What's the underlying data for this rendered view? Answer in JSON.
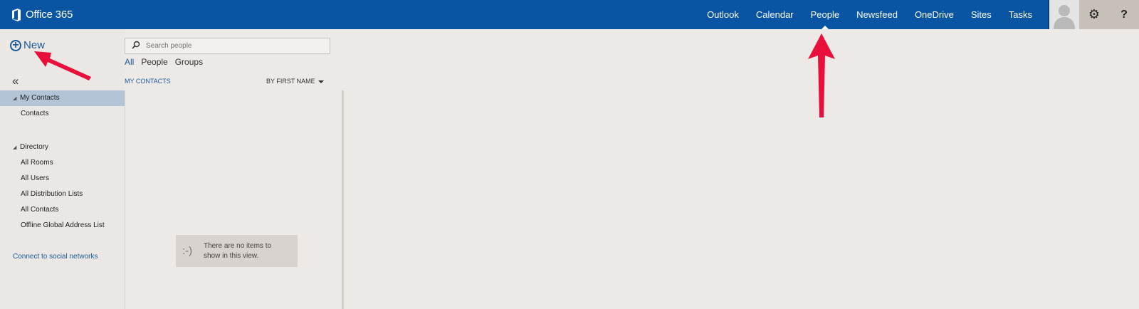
{
  "brand": {
    "title": "Office 365"
  },
  "nav": {
    "items": [
      "Outlook",
      "Calendar",
      "People",
      "Newsfeed",
      "OneDrive",
      "Sites",
      "Tasks"
    ],
    "active": "People"
  },
  "topbar": {
    "gear_icon": "gear-icon",
    "help_label": "?"
  },
  "leftnav": {
    "new_label": "New",
    "collapse_label": "«",
    "my_contacts": "My Contacts",
    "contacts": "Contacts",
    "directory": "Directory",
    "dir_items": [
      "All Rooms",
      "All Users",
      "All Distribution Lists",
      "All Contacts",
      "Offline Global Address List"
    ],
    "social_label": "Connect to social networks"
  },
  "search": {
    "placeholder": "Search people"
  },
  "filters": [
    "All",
    "People",
    "Groups"
  ],
  "list": {
    "header": "MY CONTACTS",
    "sort_label": "BY FIRST NAME",
    "empty_face": ":-)",
    "empty_message": "There are no items to show in this view."
  },
  "colors": {
    "topbar": "#0a55a3",
    "accent": "#1b5b9c",
    "arrow": "#e8103a"
  }
}
